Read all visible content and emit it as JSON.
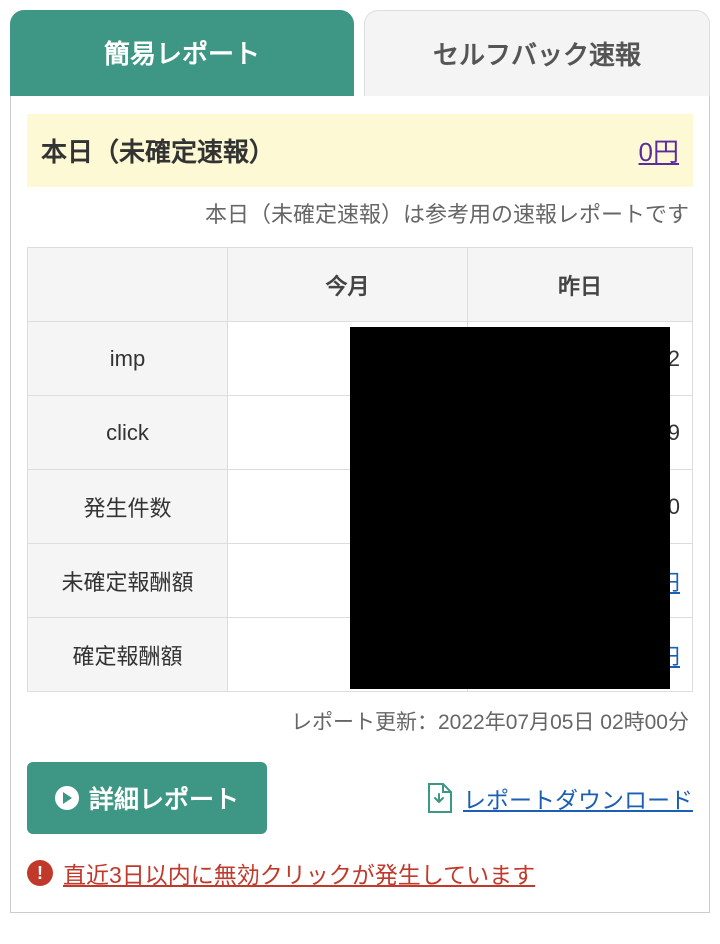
{
  "tabs": {
    "simple_report": "簡易レポート",
    "selfback": "セルフバック速報"
  },
  "today": {
    "title": "本日（未確定速報）",
    "amount": "0円",
    "note": "本日（未確定速報）は参考用の速報レポートです"
  },
  "table": {
    "col_label_month": "今月",
    "col_label_yesterday": "昨日",
    "rows": {
      "imp": {
        "label": "imp",
        "month": "",
        "yesterday": "92"
      },
      "click": {
        "label": "click",
        "month": "",
        "yesterday": "49"
      },
      "occur": {
        "label": "発生件数",
        "month": "",
        "yesterday": "0"
      },
      "unconfirmed": {
        "label": "未確定報酬額",
        "month": "",
        "yesterday": "円"
      },
      "confirmed": {
        "label": "確定報酬額",
        "month": "",
        "yesterday": "円"
      }
    }
  },
  "updated": {
    "prefix": "レポート更新：",
    "value": "2022年07月05日 02時00分"
  },
  "actions": {
    "detail": "詳細レポート",
    "download": "レポートダウンロード"
  },
  "alert": "直近3日以内に無効クリックが発生しています"
}
